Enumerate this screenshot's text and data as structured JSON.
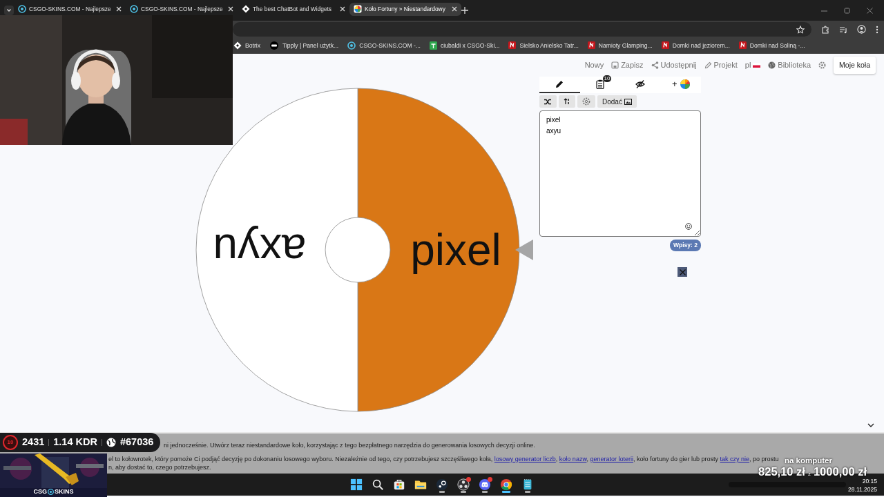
{
  "browser": {
    "tabs": [
      {
        "title": "CSGO-SKINS.COM - Najlepsze",
        "kind": "target",
        "selected": false
      },
      {
        "title": "CSGO-SKINS.COM - Najlepsze",
        "kind": "target",
        "selected": false
      },
      {
        "title": "The best ChatBot and Widgets",
        "kind": "diamond",
        "selected": false
      },
      {
        "title": "Koło Fortuny » Niestandardowy",
        "kind": "colorwheel",
        "selected": true
      }
    ],
    "bookmarks": [
      {
        "label": "Botrix",
        "kind": "diamond"
      },
      {
        "label": "Tipply | Panel użytk...",
        "kind": "tip"
      },
      {
        "label": "CSGO-SKINS.COM -...",
        "kind": "target"
      },
      {
        "label": "ciubaldi x CSGO-Ski...",
        "kind": "sheet"
      },
      {
        "label": "Sielsko Anielsko Tatr...",
        "kind": "n"
      },
      {
        "label": "Namioty Glamping...",
        "kind": "n"
      },
      {
        "label": "Domki nad jeziorem...",
        "kind": "n"
      },
      {
        "label": "Domki nad Soliną -...",
        "kind": "n"
      }
    ]
  },
  "page": {
    "toolbar": [
      {
        "label": "Nowy",
        "kind": "plain"
      },
      {
        "label": "Zapisz",
        "kind": "save"
      },
      {
        "label": "Udostępnij",
        "kind": "share"
      },
      {
        "label": "Projekt",
        "kind": "pencil"
      },
      {
        "label": "pl",
        "kind": "flag"
      },
      {
        "label": "Biblioteka",
        "kind": "globe"
      },
      {
        "kind": "settings"
      }
    ],
    "my_wheels_button": "Moje koła",
    "wheel": {
      "segments": [
        {
          "label": "pixel",
          "color": "#d97716"
        },
        {
          "label": "axyu",
          "color": "#ffffff"
        }
      ]
    },
    "editor": {
      "tabs": [
        {
          "kind": "edit",
          "selected": true
        },
        {
          "kind": "list",
          "selected": false,
          "badge": "10"
        },
        {
          "kind": "hide",
          "selected": false
        },
        {
          "kind": "colors",
          "selected": false,
          "label": "+"
        }
      ],
      "add_button": "Dodać",
      "entries": "pixel\naxyu",
      "count": "Wpisy: 2"
    },
    "description": {
      "lines": [
        [
          {
            "kind": "text",
            "text": "ni jednocześnie. Utwórz teraz niestandardowe koło, korzystając z tego bezpłatnego narzędzia do generowania losowych decyzji online."
          }
        ],
        [
          {
            "kind": "text",
            "text": "el to kołowrotek, który pomoże Ci podjąć decyzję po dokonaniu losowego wyboru. Niezależnie od tego, czy potrzebujesz szczęśliwego koła, "
          },
          {
            "kind": "link",
            "text": "losowy generator liczb"
          },
          {
            "kind": "text",
            "text": ", "
          },
          {
            "kind": "link",
            "text": "koło nazw"
          },
          {
            "kind": "text",
            "text": ", "
          },
          {
            "kind": "link",
            "text": "generator loterii"
          },
          {
            "kind": "text",
            "text": ", koło fortuny do gier lub prosty "
          },
          {
            "kind": "link",
            "text": "tak czy nie"
          },
          {
            "kind": "text",
            "text": ", po prostu"
          }
        ],
        [
          {
            "kind": "text",
            "text": "n, aby dostać to, czego potrzebujesz."
          }
        ]
      ]
    }
  },
  "overlays": {
    "stats": {
      "level": "10",
      "elo": "2431",
      "kdr": "1.14 KDR",
      "rank": "#67036"
    },
    "promo": {
      "brand_left": "CSG",
      "brand_right": "SKINS"
    },
    "donation": {
      "title": "na komputer",
      "raised": "825,10 zł",
      "separator": "z",
      "goal": "1000,00 zł"
    }
  },
  "taskbar": {
    "apps": [
      {
        "kind": "windows",
        "running": false,
        "active": false,
        "notification": false
      },
      {
        "kind": "search",
        "running": false,
        "active": false,
        "notification": false
      },
      {
        "kind": "store",
        "running": false,
        "active": false,
        "notification": false
      },
      {
        "kind": "folder",
        "running": false,
        "active": false,
        "notification": false
      },
      {
        "kind": "steam",
        "running": true,
        "active": false,
        "notification": false
      },
      {
        "kind": "obs",
        "running": true,
        "active": false,
        "notification": true
      },
      {
        "kind": "discord",
        "running": true,
        "active": false,
        "notification": true
      },
      {
        "kind": "chrome",
        "active": true,
        "notification": false
      },
      {
        "kind": "notepad",
        "running": true,
        "active": false,
        "notification": false
      }
    ],
    "time": "20:15",
    "date": "28.11.2025"
  }
}
